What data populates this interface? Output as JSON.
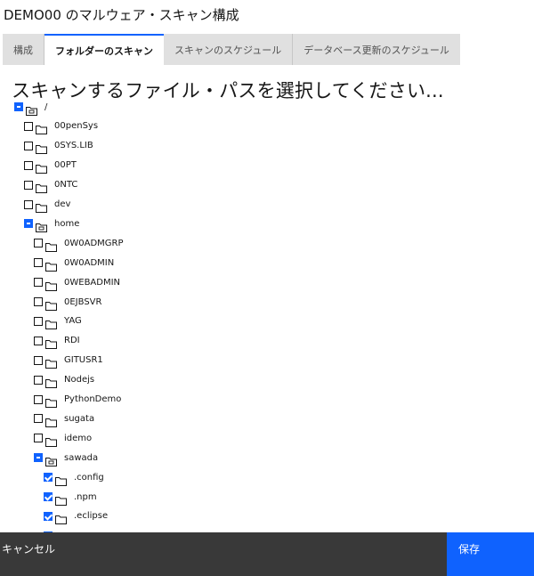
{
  "title": "DEMO00 のマルウェア・スキャン構成",
  "tabs": [
    {
      "label": "構成",
      "selected": false
    },
    {
      "label": "フォルダーのスキャン",
      "selected": true
    },
    {
      "label": "スキャンのスケジュール",
      "selected": false
    },
    {
      "label": "データベース更新のスケジュール",
      "selected": false
    }
  ],
  "heading": "スキャンするファイル・パスを選択してください...",
  "tree": [
    {
      "label": "/",
      "level": 0,
      "state": "indeterminate",
      "open": true
    },
    {
      "label": "00penSys",
      "level": 1,
      "state": "unchecked",
      "open": false
    },
    {
      "label": "0SYS.LIB",
      "level": 1,
      "state": "unchecked",
      "open": false
    },
    {
      "label": "00PT",
      "level": 1,
      "state": "unchecked",
      "open": false
    },
    {
      "label": "0NTC",
      "level": 1,
      "state": "unchecked",
      "open": false
    },
    {
      "label": "dev",
      "level": 1,
      "state": "unchecked",
      "open": false
    },
    {
      "label": "home",
      "level": 1,
      "state": "indeterminate",
      "open": true
    },
    {
      "label": "0W0ADMGRP",
      "level": 2,
      "state": "unchecked",
      "open": false
    },
    {
      "label": "0W0ADMIN",
      "level": 2,
      "state": "unchecked",
      "open": false
    },
    {
      "label": "0WEBADMIN",
      "level": 2,
      "state": "unchecked",
      "open": false
    },
    {
      "label": "0EJBSVR",
      "level": 2,
      "state": "unchecked",
      "open": false
    },
    {
      "label": "YAG",
      "level": 2,
      "state": "unchecked",
      "open": false
    },
    {
      "label": "RDI",
      "level": 2,
      "state": "unchecked",
      "open": false
    },
    {
      "label": "GITUSR1",
      "level": 2,
      "state": "unchecked",
      "open": false
    },
    {
      "label": "Nodejs",
      "level": 2,
      "state": "unchecked",
      "open": false
    },
    {
      "label": "PythonDemo",
      "level": 2,
      "state": "unchecked",
      "open": false
    },
    {
      "label": "sugata",
      "level": 2,
      "state": "unchecked",
      "open": false
    },
    {
      "label": "idemo",
      "level": 2,
      "state": "unchecked",
      "open": false
    },
    {
      "label": "sawada",
      "level": 2,
      "state": "indeterminate",
      "open": true
    },
    {
      "label": ".config",
      "level": 3,
      "state": "checked",
      "open": false
    },
    {
      "label": ".npm",
      "level": 3,
      "state": "checked",
      "open": false
    },
    {
      "label": ".eclipse",
      "level": 3,
      "state": "checked",
      "open": false
    },
    {
      "label": "",
      "level": 3,
      "state": "checked",
      "open": false
    }
  ],
  "footer": {
    "cancel_label": "キャンセル",
    "save_label": "保存"
  },
  "colors": {
    "accent": "#0f62fe",
    "footer_dark": "#393939",
    "tab_bar": "#e0e0e0"
  },
  "icons": {
    "folder_closed": "folder-icon",
    "folder_open": "folder-open-icon"
  }
}
